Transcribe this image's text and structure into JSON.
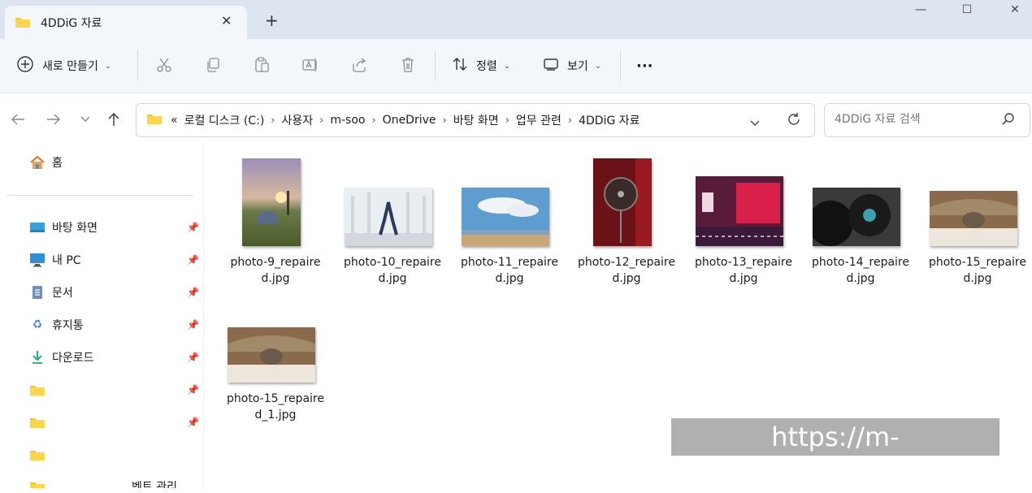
{
  "window": {
    "tab_title": "4DDiG 자료",
    "tab_close": "✕",
    "new_tab": "+",
    "minimize": "—",
    "maximize": "☐",
    "close": "✕"
  },
  "toolbar": {
    "new_label": "새로 만들기",
    "sort_label": "정렬",
    "view_label": "보기",
    "more_label": "···"
  },
  "address": {
    "overflow": "«",
    "crumbs": [
      "로컬 디스크 (C:)",
      "사용자",
      "m-soo",
      "OneDrive",
      "바탕 화면",
      "업무 관련",
      "4DDiG 자료"
    ]
  },
  "search": {
    "placeholder": "4DDiG 자료 검색"
  },
  "sidebar": {
    "home": "홈",
    "items": [
      {
        "label": "바탕 화면",
        "icon": "desktop-icon"
      },
      {
        "label": "내 PC",
        "icon": "pc-icon"
      },
      {
        "label": "문서",
        "icon": "document-icon"
      },
      {
        "label": "휴지통",
        "icon": "recycle-bin-icon"
      },
      {
        "label": "다운로드",
        "icon": "download-icon"
      },
      {
        "label": "",
        "icon": "folder-icon"
      },
      {
        "label": "",
        "icon": "folder-icon"
      },
      {
        "label": "",
        "icon": "folder-icon"
      },
      {
        "label": "벤트 관리",
        "icon": "folder-icon"
      }
    ]
  },
  "files": [
    {
      "line1": "photo-9_repaire",
      "line2": "d.jpg"
    },
    {
      "line1": "photo-10_repaire",
      "line2": "d.jpg"
    },
    {
      "line1": "photo-11_repaire",
      "line2": "d.jpg"
    },
    {
      "line1": "photo-12_repaire",
      "line2": "d.jpg"
    },
    {
      "line1": "photo-13_repaire",
      "line2": "d.jpg"
    },
    {
      "line1": "photo-14_repaire",
      "line2": "d.jpg"
    },
    {
      "line1": "photo-15_repaire",
      "line2": "d.jpg"
    },
    {
      "line1": "photo-15_repaire",
      "line2": "d_1.jpg"
    }
  ],
  "watermark": "https://m-sooriya.tistory.com",
  "colors": {
    "titlebar": "#dde5f0",
    "toolbar": "#f3f6fa",
    "folder": "#f5c518",
    "accent": "#0067c0"
  }
}
